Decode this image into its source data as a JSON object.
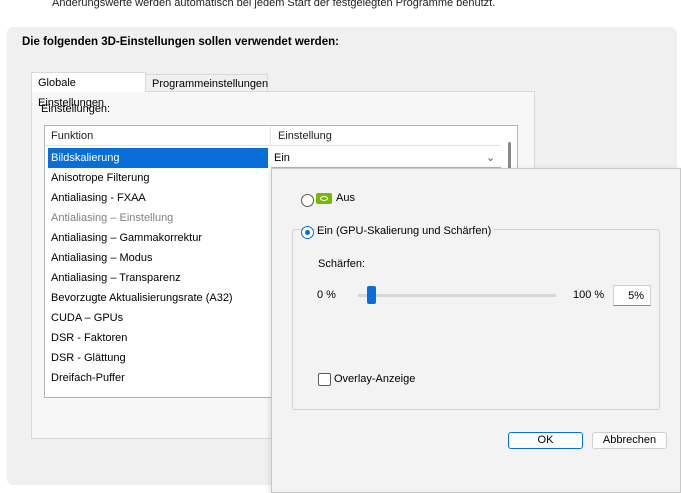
{
  "top_note": "Änderungswerte werden automatisch bei jedem Start der festgelegten Programme benutzt.",
  "heading": "Die folgenden 3D-Einstellungen sollen verwendet werden:",
  "tabs": [
    {
      "label": "Globale Einstellungen",
      "active": true
    },
    {
      "label": "Programmeinstellungen",
      "active": false
    }
  ],
  "settings_label": "Einstellungen:",
  "columns": {
    "function": "Funktion",
    "setting": "Einstellung"
  },
  "rows": [
    {
      "label": "Bildskalierung",
      "state": "selected"
    },
    {
      "label": "Anisotrope Filterung",
      "state": "normal"
    },
    {
      "label": "Antialiasing - FXAA",
      "state": "normal"
    },
    {
      "label": "Antialiasing – Einstellung",
      "state": "disabled"
    },
    {
      "label": "Antialiasing – Gammakorrektur",
      "state": "normal"
    },
    {
      "label": "Antialiasing – Modus",
      "state": "normal"
    },
    {
      "label": "Antialiasing – Transparenz",
      "state": "normal"
    },
    {
      "label": "Bevorzugte Aktualisierungsrate (A32)",
      "state": "normal"
    },
    {
      "label": "CUDA – GPUs",
      "state": "normal"
    },
    {
      "label": "DSR - Faktoren",
      "state": "normal"
    },
    {
      "label": "DSR - Glättung",
      "state": "normal"
    },
    {
      "label": "Dreifach-Puffer",
      "state": "normal"
    }
  ],
  "selected_value": "Ein",
  "popup": {
    "option_off": "Aus",
    "option_on": "Ein (GPU-Skalierung und Schärfen)",
    "selected_option": "on",
    "sharpen_label": "Schärfen:",
    "slider_min": "0 %",
    "slider_max": "100 %",
    "slider_value_fraction": 0.05,
    "sharpen_value": "5%",
    "overlay_label": "Overlay-Anzeige",
    "overlay_checked": false,
    "ok_label": "OK",
    "cancel_label": "Abbrechen"
  },
  "colors": {
    "accent": "#0a6ed9",
    "nvidia_green": "#76b900"
  },
  "icons": {
    "nvidia": "nvidia-logo-icon",
    "dropdown": "chevron-down-icon"
  }
}
